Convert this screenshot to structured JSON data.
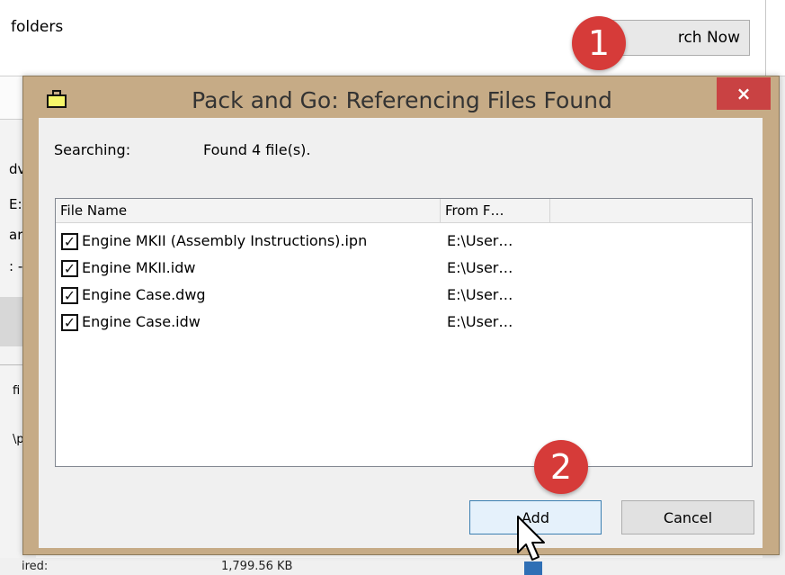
{
  "background": {
    "top_text": "folders",
    "search_button": "rch Now",
    "left_fragments": [
      "dv",
      "E:",
      "ar",
      ": -",
      "fi",
      "\\p"
    ],
    "bottom_fragments": [
      "ired:",
      "1,799.56 KB"
    ]
  },
  "dialog": {
    "title": "Pack and Go: Referencing Files Found",
    "close_label": "×",
    "searching_label": "Searching:",
    "searching_value": "Found 4 file(s).",
    "columns": [
      "File Name",
      "From F…"
    ],
    "files": [
      {
        "name": "Engine MKII (Assembly Instructions).ipn",
        "from": "E:\\User…",
        "checked": true
      },
      {
        "name": "Engine MKII.idw",
        "from": "E:\\User…",
        "checked": true
      },
      {
        "name": "Engine Case.dwg",
        "from": "E:\\User…",
        "checked": true
      },
      {
        "name": "Engine Case.idw",
        "from": "E:\\User…",
        "checked": true
      }
    ],
    "add_button": "Add",
    "cancel_button": "Cancel"
  },
  "markers": [
    "1",
    "2"
  ],
  "colors": {
    "dialog_frame": "#c6ab86",
    "close_button": "#c94243",
    "marker": "#d63b39",
    "client_bg": "#f0f0f0"
  }
}
